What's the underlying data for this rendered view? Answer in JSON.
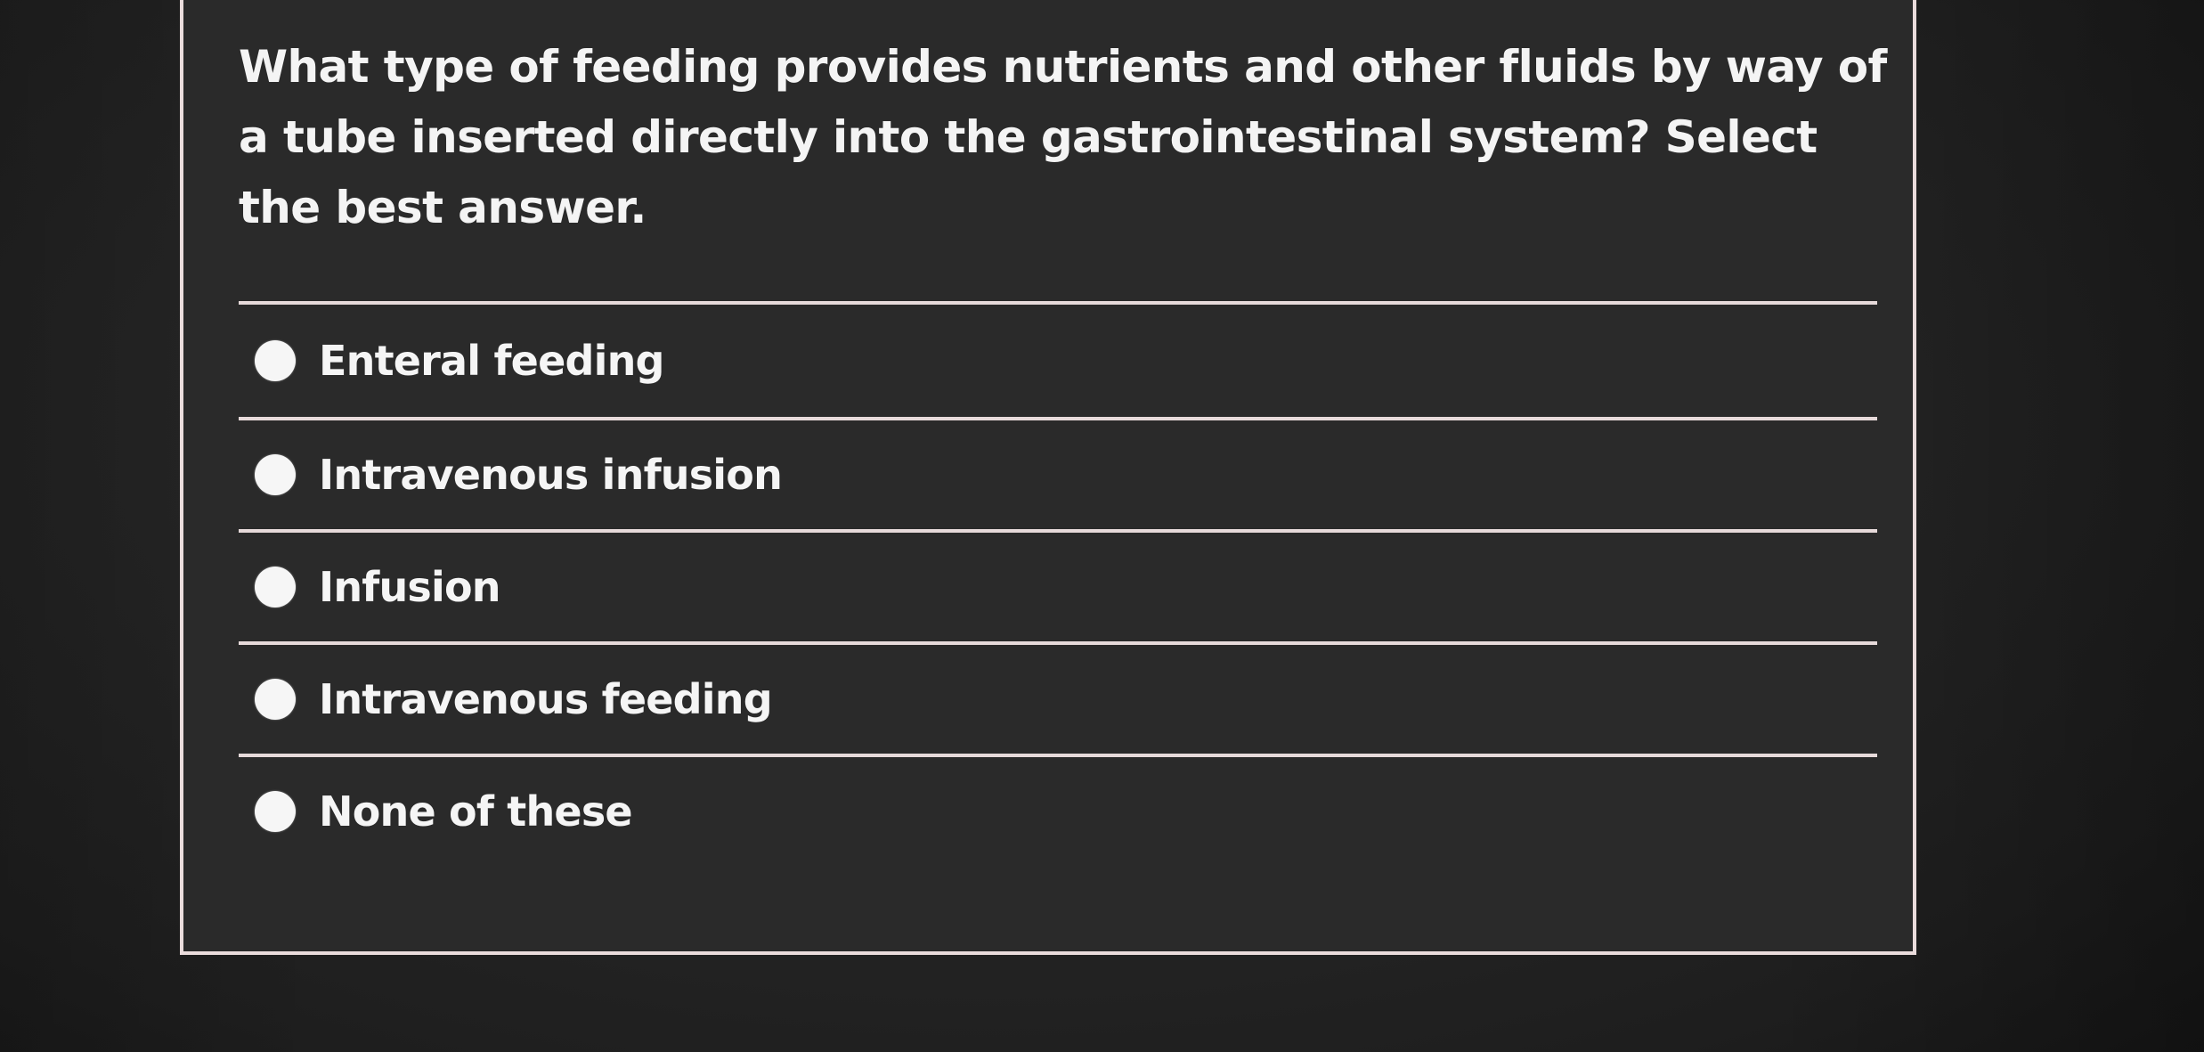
{
  "question": {
    "text": "What type of feeding provides nutrients and other fluids by way of a tube inserted directly into the gastrointestinal system? Select the best answer."
  },
  "options": [
    {
      "label": "Enteral feeding"
    },
    {
      "label": "Intravenous infusion"
    },
    {
      "label": "Infusion"
    },
    {
      "label": "Intravenous feeding"
    },
    {
      "label": "None of these"
    }
  ],
  "colors": {
    "background": "#262626",
    "card": "#2a2a2a",
    "border": "#eadcdc",
    "text": "#f4f4f4",
    "radio": "#f6f6f6"
  }
}
